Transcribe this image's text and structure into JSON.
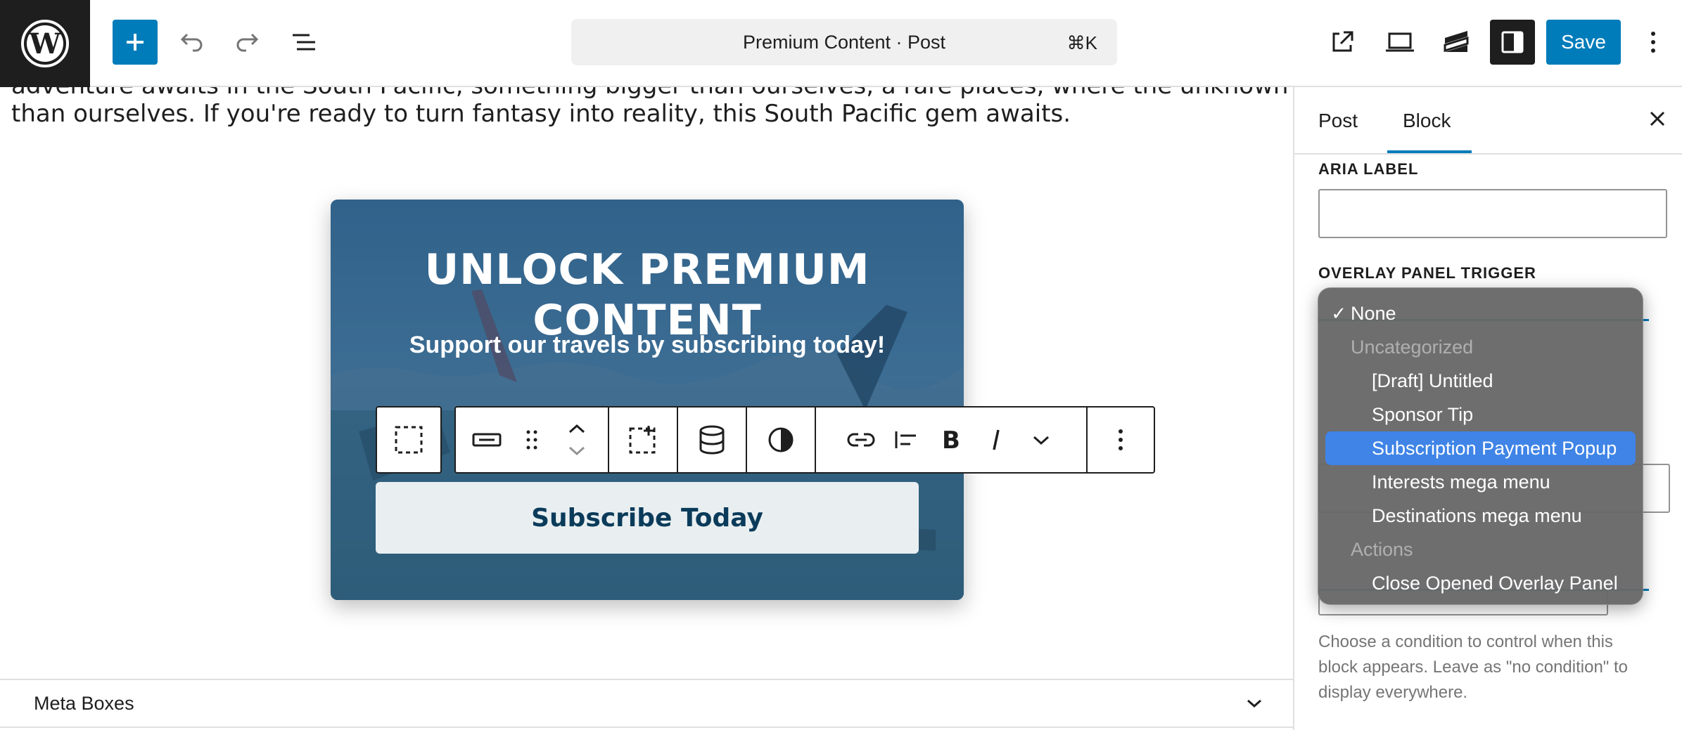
{
  "topbar": {
    "command_title": "Premium Content · Post",
    "command_shortcut": "⌘K",
    "save_label": "Save"
  },
  "canvas": {
    "cut_line": "adventure awaits in the South Pacific, something bigger than ourselves, a rare places, where the unknown calls and stirs something bigger",
    "paragraph_line": "than ourselves. If you're ready to turn fantasy into reality, this South Pacific gem awaits.",
    "hero": {
      "title_line1": "UNLOCK PREMIUM",
      "title_line2": "CONTENT",
      "subtitle": "Support our travels by subscribing today!",
      "button_label": "Subscribe Today"
    },
    "meta_boxes_label": "Meta Boxes"
  },
  "sidebar": {
    "tabs": [
      {
        "label": "Post"
      },
      {
        "label": "Block",
        "active": true
      }
    ],
    "aria_label_heading": "ARIA LABEL",
    "aria_label_value": "",
    "overlay_trigger_heading": "OVERLAY PANEL TRIGGER",
    "help_text": "Choose a condition to control when this block appears. Leave as \"no condition\" to display everywhere.",
    "dropdown": {
      "items": [
        {
          "label": "None",
          "checked": true,
          "kind": "option"
        },
        {
          "label": "Uncategorized",
          "kind": "group"
        },
        {
          "label": "[Draft] Untitled",
          "kind": "option"
        },
        {
          "label": "Sponsor Tip",
          "kind": "option"
        },
        {
          "label": "Subscription Payment Popup",
          "kind": "option",
          "highlighted": true
        },
        {
          "label": "Interests mega menu",
          "kind": "option"
        },
        {
          "label": "Destinations mega menu",
          "kind": "option"
        },
        {
          "label": "Actions",
          "kind": "group"
        },
        {
          "label": "Close Opened Overlay Panel",
          "kind": "option"
        }
      ]
    }
  },
  "colors": {
    "accent": "#007cba",
    "highlight": "#3f84e6",
    "dark": "#1e1e1e"
  }
}
